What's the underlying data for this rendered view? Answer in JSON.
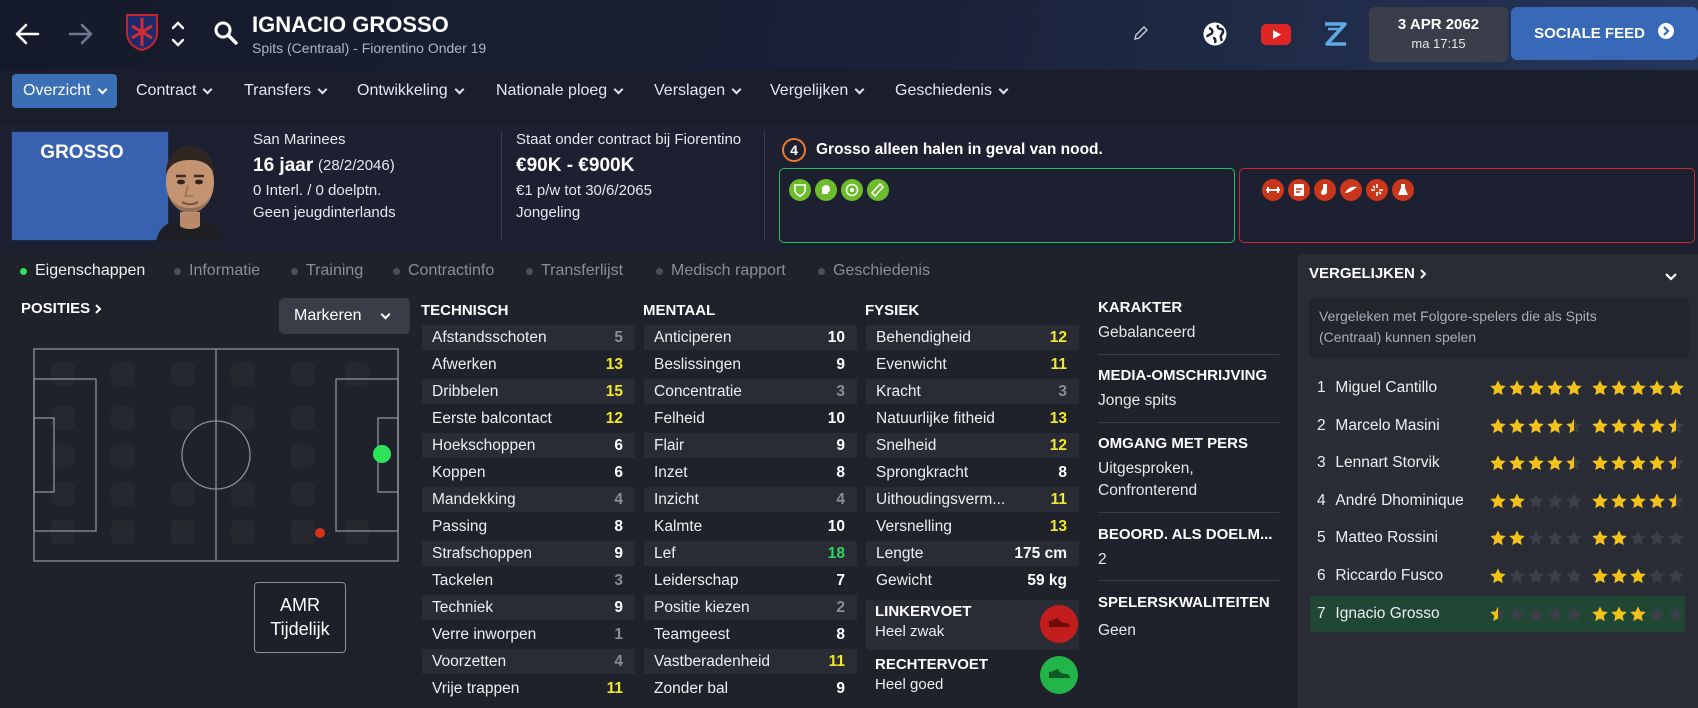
{
  "header": {
    "player_name": "IGNACIO GROSSO",
    "subtitle": "Spits (Centraal) - Fiorentino Onder 19",
    "date": "3 APR 2062",
    "time": "ma 17:15",
    "social_feed_label": "SOCIALE FEED"
  },
  "nav": {
    "tabs": [
      "Overzicht",
      "Contract",
      "Transfers",
      "Ontwikkeling",
      "Nationale ploeg",
      "Verslagen",
      "Vergelijken",
      "Geschiedenis"
    ]
  },
  "profile": {
    "card_name": "GROSSO",
    "nationality": "San Marinees",
    "age": "16 jaar",
    "dob": "(28/2/2046)",
    "caps": "0 Interl. / 0 doelptn.",
    "youth_caps": "Geen jeugdinterlands",
    "contract_label": "Staat onder contract bij Fiorentino",
    "value": "€90K - €900K",
    "wage": "€1 p/w tot 30/6/2065",
    "contract_type": "Jongeling",
    "scout_number": "4",
    "scout_text": "Grosso alleen halen in geval van nood."
  },
  "subtabs": [
    "Eigenschappen",
    "Informatie",
    "Training",
    "Contractinfo",
    "Transferlijst",
    "Medisch rapport",
    "Geschiedenis"
  ],
  "positions": {
    "title": "POSITIES",
    "highlight_label": "Markeren",
    "role_line1": "AMR",
    "role_line2": "Tijdelijk"
  },
  "technical": {
    "title": "TECHNISCH",
    "rows": [
      {
        "name": "Afstandsschoten",
        "value": "5",
        "c": "g"
      },
      {
        "name": "Afwerken",
        "value": "13",
        "c": "y"
      },
      {
        "name": "Dribbelen",
        "value": "15",
        "c": "y"
      },
      {
        "name": "Eerste balcontact",
        "value": "12",
        "c": "y"
      },
      {
        "name": "Hoekschoppen",
        "value": "6",
        "c": "w"
      },
      {
        "name": "Koppen",
        "value": "6",
        "c": "w"
      },
      {
        "name": "Mandekking",
        "value": "4",
        "c": "g"
      },
      {
        "name": "Passing",
        "value": "8",
        "c": "w"
      },
      {
        "name": "Strafschoppen",
        "value": "9",
        "c": "w"
      },
      {
        "name": "Tackelen",
        "value": "3",
        "c": "g"
      },
      {
        "name": "Techniek",
        "value": "9",
        "c": "w"
      },
      {
        "name": "Verre inworpen",
        "value": "1",
        "c": "g"
      },
      {
        "name": "Voorzetten",
        "value": "4",
        "c": "g"
      },
      {
        "name": "Vrije trappen",
        "value": "11",
        "c": "y"
      }
    ]
  },
  "mental": {
    "title": "MENTAAL",
    "rows": [
      {
        "name": "Anticiperen",
        "value": "10",
        "c": "w"
      },
      {
        "name": "Beslissingen",
        "value": "9",
        "c": "w"
      },
      {
        "name": "Concentratie",
        "value": "3",
        "c": "g"
      },
      {
        "name": "Felheid",
        "value": "10",
        "c": "w"
      },
      {
        "name": "Flair",
        "value": "9",
        "c": "w"
      },
      {
        "name": "Inzet",
        "value": "8",
        "c": "w"
      },
      {
        "name": "Inzicht",
        "value": "4",
        "c": "g"
      },
      {
        "name": "Kalmte",
        "value": "10",
        "c": "w"
      },
      {
        "name": "Lef",
        "value": "18",
        "c": "gr"
      },
      {
        "name": "Leiderschap",
        "value": "7",
        "c": "w"
      },
      {
        "name": "Positie kiezen",
        "value": "2",
        "c": "g"
      },
      {
        "name": "Teamgeest",
        "value": "8",
        "c": "w"
      },
      {
        "name": "Vastberadenheid",
        "value": "11",
        "c": "y"
      },
      {
        "name": "Zonder bal",
        "value": "9",
        "c": "w"
      }
    ]
  },
  "physical": {
    "title": "FYSIEK",
    "rows": [
      {
        "name": "Behendigheid",
        "value": "12",
        "c": "y"
      },
      {
        "name": "Evenwicht",
        "value": "11",
        "c": "y"
      },
      {
        "name": "Kracht",
        "value": "3",
        "c": "g"
      },
      {
        "name": "Natuurlijke fitheid",
        "value": "13",
        "c": "y"
      },
      {
        "name": "Snelheid",
        "value": "12",
        "c": "y"
      },
      {
        "name": "Sprongkracht",
        "value": "8",
        "c": "w"
      },
      {
        "name": "Uithoudingsverm...",
        "value": "11",
        "c": "y"
      },
      {
        "name": "Versnelling",
        "value": "13",
        "c": "y"
      },
      {
        "name": "Lengte",
        "value": "175 cm",
        "c": "w"
      },
      {
        "name": "Gewicht",
        "value": "59 kg",
        "c": "w"
      }
    ],
    "left_foot_label": "LINKERVOET",
    "left_foot_value": "Heel zwak",
    "right_foot_label": "RECHTERVOET",
    "right_foot_value": "Heel goed"
  },
  "info": {
    "character_label": "KARAKTER",
    "character_value": "Gebalanceerd",
    "media_label": "MEDIA-OMSCHRIJVING",
    "media_value": "Jonge spits",
    "press_label": "OMGANG MET PERS",
    "press_value1": "Uitgesproken,",
    "press_value2": "Confronterend",
    "gk_label": "BEOORD. ALS DOELM...",
    "gk_value": "2",
    "traits_label": "SPELERSKWALITEITEN",
    "traits_value": "Geen"
  },
  "compare": {
    "title": "VERGELIJKEN",
    "description1": "Vergeleken met Folgore-spelers die als Spits",
    "description2": "(Centraal) kunnen spelen",
    "rows": [
      {
        "rank": "1",
        "name": "Miguel Cantillo",
        "ca": 5,
        "pa": 5
      },
      {
        "rank": "2",
        "name": "Marcelo Masini",
        "ca": 4.5,
        "pa": 4.5
      },
      {
        "rank": "3",
        "name": "Lennart Storvik",
        "ca": 4.5,
        "pa": 4.5
      },
      {
        "rank": "4",
        "name": "André Dhominique",
        "ca": 2,
        "pa": 4.5
      },
      {
        "rank": "5",
        "name": "Matteo Rossini",
        "ca": 2,
        "pa": 2
      },
      {
        "rank": "6",
        "name": "Riccardo Fusco",
        "ca": 1,
        "pa": 3
      },
      {
        "rank": "7",
        "name": "Ignacio Grosso",
        "ca": 0.5,
        "pa": 3
      }
    ]
  },
  "colors": {
    "accent": "#3b6fb5",
    "good_box": "#23c25c",
    "bad_box": "#d02430",
    "star": "#f2c21b"
  }
}
